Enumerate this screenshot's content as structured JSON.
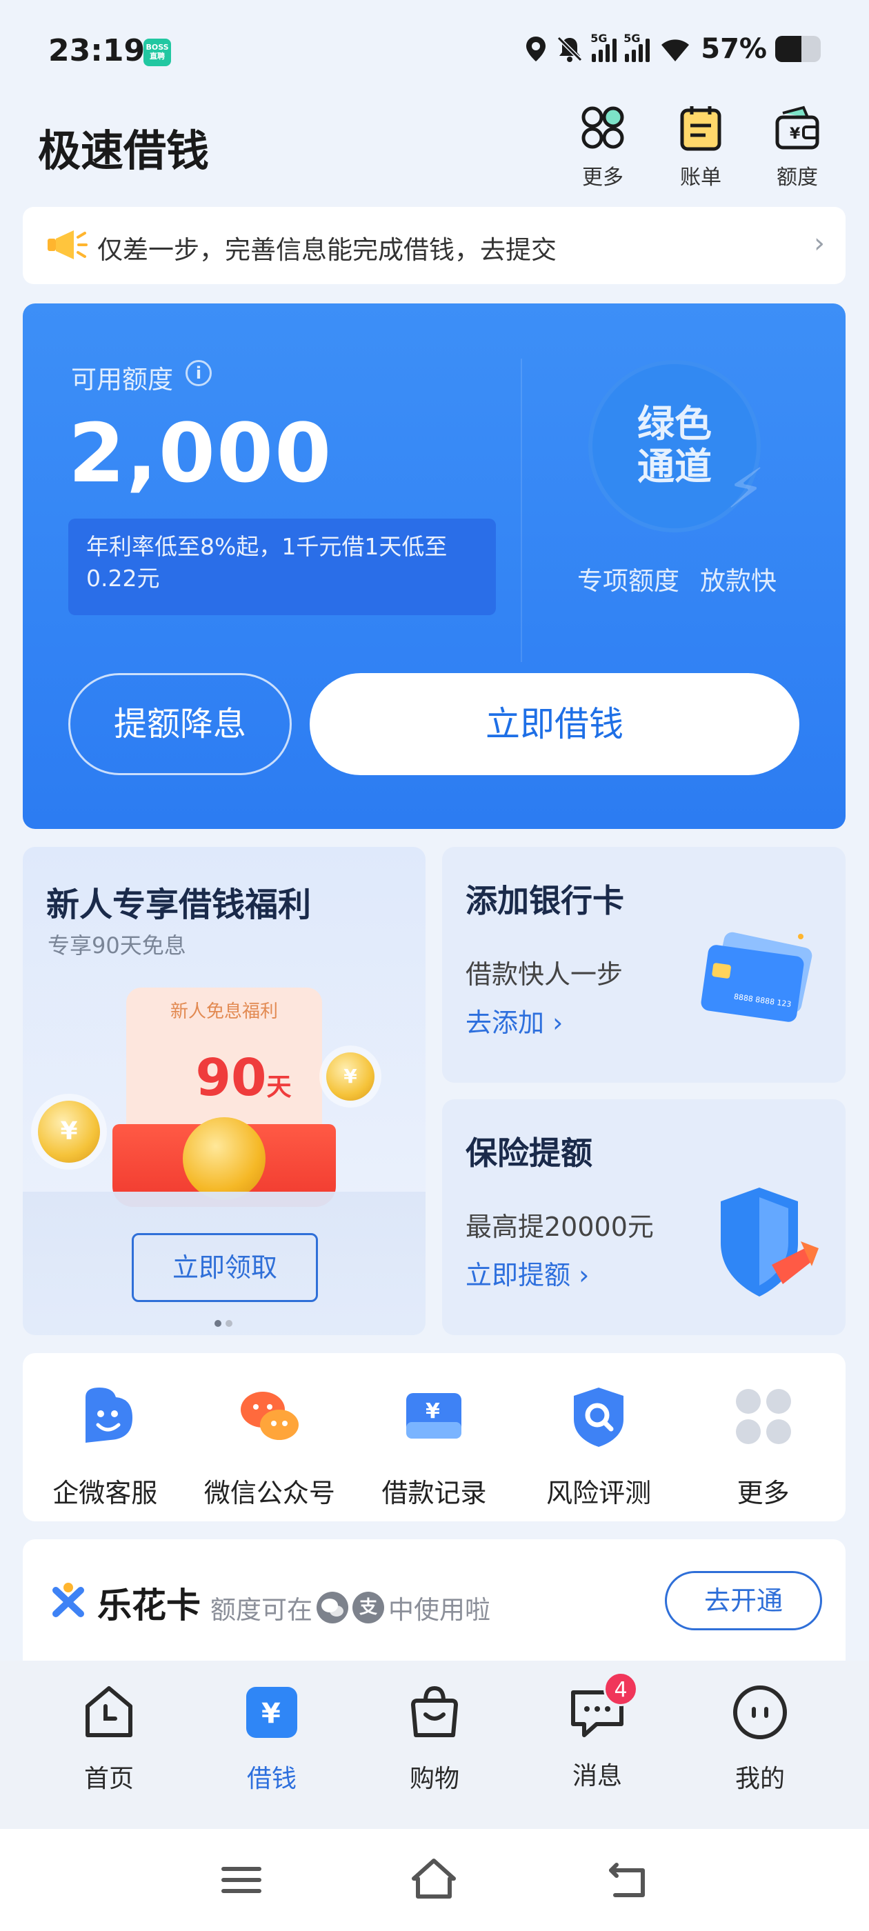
{
  "status_bar": {
    "time": "23:19",
    "boss_badge": "BOSS直聘",
    "network_1": "5G",
    "network_2": "5G",
    "battery": "57%",
    "battery_level": 0.57
  },
  "header": {
    "title": "极速借钱",
    "buttons": [
      {
        "label": "更多",
        "icon": "grid-icon"
      },
      {
        "label": "账单",
        "icon": "bill-icon"
      },
      {
        "label": "额度",
        "icon": "wallet-icon"
      }
    ]
  },
  "notice": {
    "text": "仅差一步，完善信息能完成借钱，去提交",
    "arrow": "›"
  },
  "credit": {
    "label": "可用额度",
    "info_glyph": "i",
    "amount": "2,000",
    "rate_text": "年利率低至8%起，1千元借1天低至0.22元",
    "channel_title": "绿色通道",
    "channel_tags": [
      "专项额度",
      "放款快"
    ],
    "raise_button": "提额降息",
    "borrow_button": "立即借钱"
  },
  "welfare": {
    "title": "新人专享借钱福利",
    "subtitle": "专享90天免息",
    "envelope_label": "新人免息福利",
    "days_number": "90",
    "days_unit": "天",
    "coin_glyph": "¥",
    "claim_button": "立即领取"
  },
  "bank_card": {
    "title": "添加银行卡",
    "desc": "借款快人一步",
    "link": "去添加 ›",
    "card_number": "8888 8888 123"
  },
  "insurance": {
    "title": "保险提额",
    "desc": "最高提20000元",
    "link": "立即提额 ›"
  },
  "services": [
    {
      "label": "企微客服",
      "icon": "wecom-service-icon"
    },
    {
      "label": "微信公众号",
      "icon": "wechat-official-icon"
    },
    {
      "label": "借款记录",
      "icon": "loan-record-icon"
    },
    {
      "label": "风险评测",
      "icon": "risk-assessment-icon"
    },
    {
      "label": "更多",
      "icon": "more-grid-icon"
    }
  ],
  "lehua": {
    "name": "乐花卡",
    "desc_before": "额度可在",
    "desc_after": "中使用啦",
    "alipay_glyph": "支",
    "open_button": "去开通"
  },
  "bottom_nav": [
    {
      "label": "首页",
      "icon": "home-icon"
    },
    {
      "label": "借钱",
      "icon": "borrow-icon",
      "active": true
    },
    {
      "label": "购物",
      "icon": "shopping-bag-icon"
    },
    {
      "label": "消息",
      "icon": "message-icon",
      "badge": "4"
    },
    {
      "label": "我的",
      "icon": "profile-icon"
    }
  ],
  "colors": {
    "primary_blue": "#2c7cf2",
    "link_blue": "#2d6fdd",
    "badge_red": "#f0365a",
    "page_bg": "#eef3fb"
  }
}
